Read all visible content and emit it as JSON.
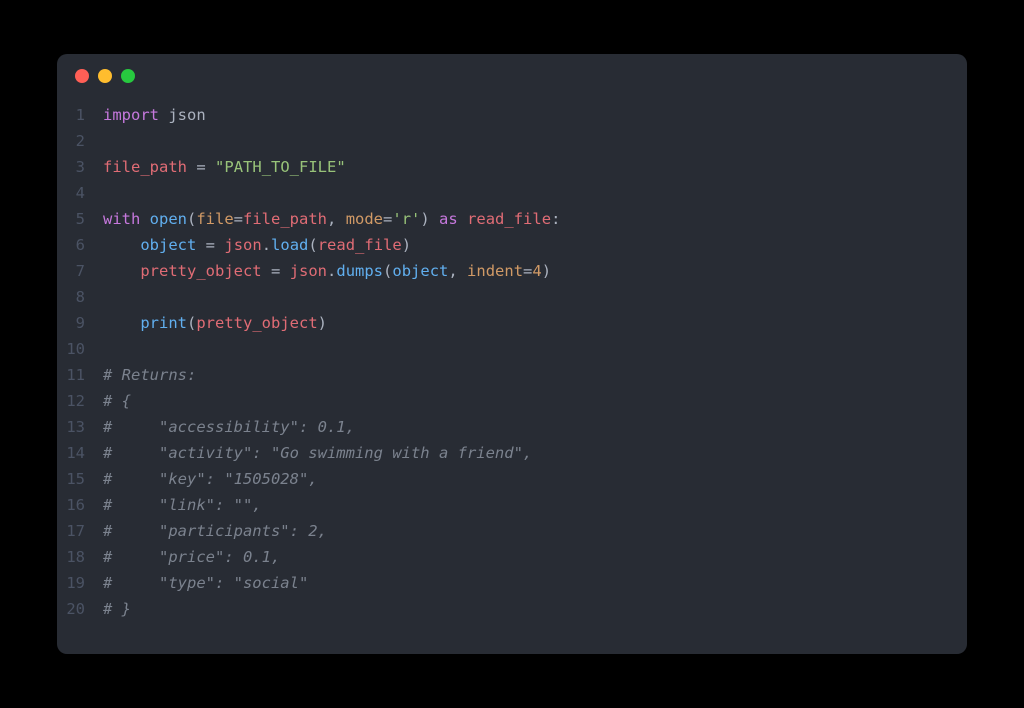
{
  "window": {
    "traffic_lights": {
      "red": "#ff5f56",
      "yellow": "#ffbd2e",
      "green": "#27c93f"
    }
  },
  "theme": {
    "background": "#282c34",
    "foreground": "#abb2bf",
    "gutter": "#4b5364",
    "keyword": "#c678dd",
    "string": "#98c379",
    "builtin": "#61afef",
    "param": "#d19a66",
    "variable": "#e06c75",
    "comment": "#7b828e"
  },
  "code": {
    "language": "python",
    "line_count": 20,
    "lines": [
      {
        "n": 1,
        "tokens": [
          [
            "keyword",
            "import"
          ],
          [
            "text",
            " "
          ],
          [
            "module",
            "json"
          ]
        ]
      },
      {
        "n": 2,
        "tokens": []
      },
      {
        "n": 3,
        "tokens": [
          [
            "var",
            "file_path"
          ],
          [
            "text",
            " "
          ],
          [
            "op",
            "="
          ],
          [
            "text",
            " "
          ],
          [
            "string",
            "\"PATH_TO_FILE\""
          ]
        ]
      },
      {
        "n": 4,
        "tokens": []
      },
      {
        "n": 5,
        "tokens": [
          [
            "keyword",
            "with"
          ],
          [
            "text",
            " "
          ],
          [
            "builtin",
            "open"
          ],
          [
            "punct",
            "("
          ],
          [
            "param",
            "file"
          ],
          [
            "op",
            "="
          ],
          [
            "var",
            "file_path"
          ],
          [
            "punct",
            ", "
          ],
          [
            "param",
            "mode"
          ],
          [
            "op",
            "="
          ],
          [
            "string",
            "'r'"
          ],
          [
            "punct",
            ")"
          ],
          [
            "text",
            " "
          ],
          [
            "keyword",
            "as"
          ],
          [
            "text",
            " "
          ],
          [
            "var",
            "read_file"
          ],
          [
            "punct",
            ":"
          ]
        ]
      },
      {
        "n": 6,
        "tokens": [
          [
            "text",
            "    "
          ],
          [
            "builtin",
            "object"
          ],
          [
            "text",
            " "
          ],
          [
            "op",
            "="
          ],
          [
            "text",
            " "
          ],
          [
            "var",
            "json"
          ],
          [
            "punct",
            "."
          ],
          [
            "method",
            "load"
          ],
          [
            "punct",
            "("
          ],
          [
            "var",
            "read_file"
          ],
          [
            "punct",
            ")"
          ]
        ]
      },
      {
        "n": 7,
        "tokens": [
          [
            "text",
            "    "
          ],
          [
            "var",
            "pretty_object"
          ],
          [
            "text",
            " "
          ],
          [
            "op",
            "="
          ],
          [
            "text",
            " "
          ],
          [
            "var",
            "json"
          ],
          [
            "punct",
            "."
          ],
          [
            "method",
            "dumps"
          ],
          [
            "punct",
            "("
          ],
          [
            "builtin",
            "object"
          ],
          [
            "punct",
            ", "
          ],
          [
            "param",
            "indent"
          ],
          [
            "op",
            "="
          ],
          [
            "number",
            "4"
          ],
          [
            "punct",
            ")"
          ]
        ]
      },
      {
        "n": 8,
        "tokens": []
      },
      {
        "n": 9,
        "tokens": [
          [
            "text",
            "    "
          ],
          [
            "builtin",
            "print"
          ],
          [
            "punct",
            "("
          ],
          [
            "var",
            "pretty_object"
          ],
          [
            "punct",
            ")"
          ]
        ]
      },
      {
        "n": 10,
        "tokens": []
      },
      {
        "n": 11,
        "tokens": [
          [
            "comment",
            "# Returns:"
          ]
        ]
      },
      {
        "n": 12,
        "tokens": [
          [
            "comment",
            "# {"
          ]
        ]
      },
      {
        "n": 13,
        "tokens": [
          [
            "comment",
            "#     \"accessibility\": 0.1,"
          ]
        ]
      },
      {
        "n": 14,
        "tokens": [
          [
            "comment",
            "#     \"activity\": \"Go swimming with a friend\","
          ]
        ]
      },
      {
        "n": 15,
        "tokens": [
          [
            "comment",
            "#     \"key\": \"1505028\","
          ]
        ]
      },
      {
        "n": 16,
        "tokens": [
          [
            "comment",
            "#     \"link\": \"\","
          ]
        ]
      },
      {
        "n": 17,
        "tokens": [
          [
            "comment",
            "#     \"participants\": 2,"
          ]
        ]
      },
      {
        "n": 18,
        "tokens": [
          [
            "comment",
            "#     \"price\": 0.1,"
          ]
        ]
      },
      {
        "n": 19,
        "tokens": [
          [
            "comment",
            "#     \"type\": \"social\""
          ]
        ]
      },
      {
        "n": 20,
        "tokens": [
          [
            "comment",
            "# }"
          ]
        ]
      }
    ]
  }
}
